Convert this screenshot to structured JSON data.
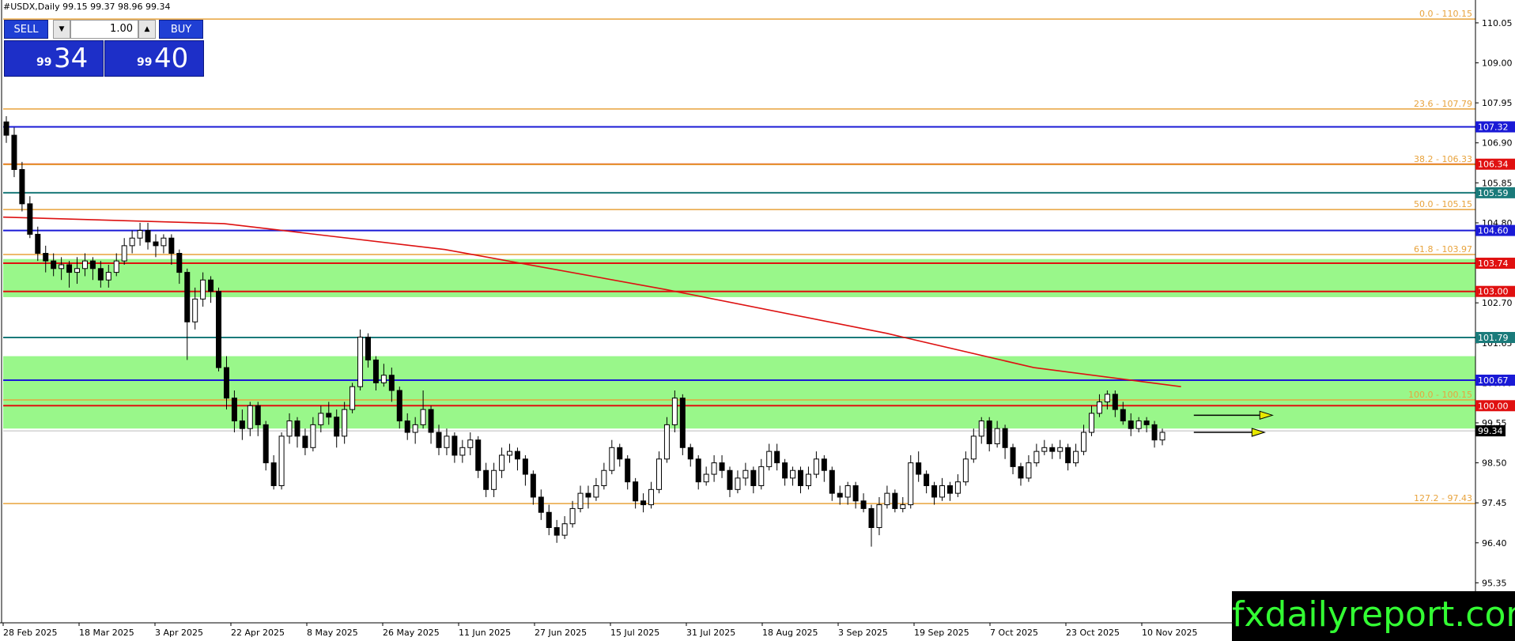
{
  "header": {
    "title": "#USDX,Daily  99.15 99.37 98.96 99.34"
  },
  "trade_panel": {
    "sell_label": "SELL",
    "buy_label": "BUY",
    "lot": "1.00",
    "sell_price_small": "99",
    "sell_price_big": "34",
    "buy_price_small": "99",
    "buy_price_big": "40",
    "down_icon": "triangle-down-icon",
    "up_icon": "triangle-up-icon"
  },
  "watermark": "fxdailyreport.com",
  "chart_data": {
    "type": "candlestick",
    "symbol": "#USDX",
    "timeframe": "Daily",
    "ohlc_last": {
      "open": 99.15,
      "high": 99.37,
      "low": 98.96,
      "close": 99.34
    },
    "last_price_label": "99.34",
    "ylim": [
      94.3,
      110.65
    ],
    "y_ticks": [
      "110.05",
      "109.00",
      "107.95",
      "106.90",
      "105.85",
      "104.80",
      "103.75",
      "102.70",
      "101.65",
      "100.60",
      "99.55",
      "98.50",
      "97.45",
      "96.40",
      "95.35"
    ],
    "x_labels": [
      "28 Feb 2025",
      "18 Mar 2025",
      "3 Apr 2025",
      "22 Apr 2025",
      "8 May 2025",
      "26 May 2025",
      "11 Jun 2025",
      "27 Jun 2025",
      "15 Jul 2025",
      "31 Jul 2025",
      "18 Aug 2025",
      "3 Sep 2025",
      "19 Sep 2025",
      "7 Oct 2025",
      "23 Oct 2025",
      "10 Nov 2025"
    ],
    "fib_levels": [
      {
        "label": "0.0 - 110.15",
        "value": 110.15
      },
      {
        "label": "23.6 - 107.79",
        "value": 107.79
      },
      {
        "label": "38.2 - 106.33",
        "value": 106.33
      },
      {
        "label": "50.0 - 105.15",
        "value": 105.15
      },
      {
        "label": "61.8 - 103.97",
        "value": 103.97
      },
      {
        "label": "100.0 - 100.15",
        "value": 100.15
      },
      {
        "label": "127.2 - 97.43",
        "value": 97.43
      }
    ],
    "fib_color": "#e8a33c",
    "horizontal_levels": [
      {
        "label": "107.32",
        "value": 107.32,
        "color": "#1a1ad6"
      },
      {
        "label": "106.34",
        "value": 106.34,
        "color": "#e0561a",
        "tag_color": "#e01010"
      },
      {
        "label": "105.59",
        "value": 105.59,
        "color": "#1a7a7a"
      },
      {
        "label": "104.60",
        "value": 104.6,
        "color": "#1a1ad6"
      },
      {
        "label": "103.74",
        "value": 103.74,
        "color": "#e01010"
      },
      {
        "label": "103.00",
        "value": 103.0,
        "color": "#e01010"
      },
      {
        "label": "101.79",
        "value": 101.79,
        "color": "#1a7a7a"
      },
      {
        "label": "100.67",
        "value": 100.67,
        "color": "#1a1ad6"
      },
      {
        "label": "100.00",
        "value": 100.0,
        "color": "#e01010"
      }
    ],
    "zones": [
      {
        "from": 102.85,
        "to": 103.85,
        "color": "#99f78a"
      },
      {
        "from": 99.4,
        "to": 101.3,
        "color": "#99f78a"
      }
    ],
    "ma_points": [
      [
        0,
        104.95
      ],
      [
        0.15,
        104.78
      ],
      [
        0.3,
        104.1
      ],
      [
        0.45,
        103.05
      ],
      [
        0.6,
        101.9
      ],
      [
        0.7,
        101.0
      ],
      [
        0.8,
        100.5
      ]
    ],
    "ma_color": "#dd1111",
    "candles": [
      [
        107.45,
        107.1,
        107.6,
        106.9
      ],
      [
        107.1,
        106.2,
        107.3,
        106.0
      ],
      [
        106.2,
        105.3,
        106.4,
        105.1
      ],
      [
        105.3,
        104.5,
        105.5,
        104.4
      ],
      [
        104.5,
        104.0,
        104.7,
        103.8
      ],
      [
        104.0,
        103.8,
        104.2,
        103.5
      ],
      [
        103.8,
        103.6,
        104.0,
        103.4
      ],
      [
        103.6,
        103.7,
        103.9,
        103.3
      ],
      [
        103.7,
        103.5,
        103.8,
        103.1
      ],
      [
        103.5,
        103.6,
        103.9,
        103.2
      ],
      [
        103.6,
        103.8,
        104.0,
        103.4
      ],
      [
        103.8,
        103.6,
        103.9,
        103.3
      ],
      [
        103.6,
        103.3,
        103.8,
        103.1
      ],
      [
        103.3,
        103.5,
        103.7,
        103.1
      ],
      [
        103.5,
        103.8,
        104.0,
        103.4
      ],
      [
        103.8,
        104.2,
        104.4,
        103.7
      ],
      [
        104.2,
        104.4,
        104.6,
        104.0
      ],
      [
        104.4,
        104.6,
        104.8,
        104.2
      ],
      [
        104.6,
        104.3,
        104.8,
        104.1
      ],
      [
        104.3,
        104.2,
        104.5,
        103.9
      ],
      [
        104.2,
        104.4,
        104.5,
        104.0
      ],
      [
        104.4,
        104.0,
        104.5,
        103.7
      ],
      [
        104.0,
        103.5,
        104.1,
        103.2
      ],
      [
        103.5,
        102.2,
        103.6,
        101.2
      ],
      [
        102.2,
        102.8,
        103.1,
        102.0
      ],
      [
        102.8,
        103.3,
        103.5,
        102.6
      ],
      [
        103.3,
        103.0,
        103.4,
        102.7
      ],
      [
        103.0,
        101.0,
        103.1,
        100.9
      ],
      [
        101.0,
        100.2,
        101.3,
        99.9
      ],
      [
        100.2,
        99.6,
        100.4,
        99.3
      ],
      [
        99.6,
        99.4,
        99.9,
        99.1
      ],
      [
        99.4,
        100.0,
        100.1,
        99.2
      ],
      [
        100.0,
        99.5,
        100.1,
        99.2
      ],
      [
        99.5,
        98.5,
        99.6,
        98.3
      ],
      [
        98.5,
        97.9,
        98.7,
        97.8
      ],
      [
        97.9,
        99.2,
        99.3,
        97.8
      ],
      [
        99.2,
        99.6,
        99.8,
        99.0
      ],
      [
        99.6,
        99.2,
        99.7,
        98.9
      ],
      [
        99.2,
        98.9,
        99.4,
        98.7
      ],
      [
        98.9,
        99.5,
        99.7,
        98.8
      ],
      [
        99.5,
        99.8,
        100.0,
        99.3
      ],
      [
        99.8,
        99.7,
        100.1,
        99.5
      ],
      [
        99.7,
        99.2,
        99.9,
        98.9
      ],
      [
        99.2,
        99.9,
        100.1,
        99.0
      ],
      [
        99.9,
        100.5,
        100.6,
        99.8
      ],
      [
        100.5,
        101.8,
        102.0,
        100.4
      ],
      [
        101.8,
        101.2,
        101.9,
        101.0
      ],
      [
        101.2,
        100.6,
        101.3,
        100.4
      ],
      [
        100.6,
        100.8,
        101.1,
        100.5
      ],
      [
        100.8,
        100.4,
        101.0,
        100.1
      ],
      [
        100.4,
        99.6,
        100.5,
        99.4
      ],
      [
        99.6,
        99.3,
        99.8,
        99.1
      ],
      [
        99.3,
        99.5,
        99.7,
        99.0
      ],
      [
        99.5,
        99.9,
        100.4,
        99.4
      ],
      [
        99.9,
        99.3,
        100.0,
        99.0
      ],
      [
        99.3,
        98.9,
        99.5,
        98.7
      ],
      [
        98.9,
        99.2,
        99.4,
        98.7
      ],
      [
        99.2,
        98.7,
        99.3,
        98.5
      ],
      [
        98.7,
        98.9,
        99.1,
        98.5
      ],
      [
        98.9,
        99.1,
        99.3,
        98.7
      ],
      [
        99.1,
        98.3,
        99.2,
        98.1
      ],
      [
        98.3,
        97.8,
        98.5,
        97.6
      ],
      [
        97.8,
        98.3,
        98.5,
        97.6
      ],
      [
        98.3,
        98.7,
        98.9,
        98.1
      ],
      [
        98.7,
        98.8,
        99.0,
        98.5
      ],
      [
        98.8,
        98.6,
        98.9,
        98.3
      ],
      [
        98.6,
        98.2,
        98.7,
        97.9
      ],
      [
        98.2,
        97.6,
        98.3,
        97.4
      ],
      [
        97.6,
        97.2,
        97.8,
        97.0
      ],
      [
        97.2,
        96.8,
        97.4,
        96.6
      ],
      [
        96.8,
        96.6,
        97.0,
        96.4
      ],
      [
        96.6,
        96.9,
        97.1,
        96.5
      ],
      [
        96.9,
        97.3,
        97.5,
        96.8
      ],
      [
        97.3,
        97.7,
        97.9,
        97.2
      ],
      [
        97.7,
        97.6,
        97.9,
        97.3
      ],
      [
        97.6,
        97.9,
        98.1,
        97.5
      ],
      [
        97.9,
        98.3,
        98.5,
        97.8
      ],
      [
        98.3,
        98.9,
        99.1,
        98.2
      ],
      [
        98.9,
        98.6,
        99.0,
        98.4
      ],
      [
        98.6,
        98.0,
        98.7,
        97.8
      ],
      [
        98.0,
        97.5,
        98.1,
        97.3
      ],
      [
        97.5,
        97.4,
        97.7,
        97.2
      ],
      [
        97.4,
        97.8,
        98.0,
        97.3
      ],
      [
        97.8,
        98.6,
        98.8,
        97.7
      ],
      [
        98.6,
        99.5,
        99.7,
        98.5
      ],
      [
        99.5,
        100.2,
        100.4,
        99.3
      ],
      [
        100.2,
        98.9,
        100.3,
        98.7
      ],
      [
        98.9,
        98.6,
        99.0,
        98.4
      ],
      [
        98.6,
        98.0,
        98.7,
        97.8
      ],
      [
        98.0,
        98.2,
        98.4,
        97.9
      ],
      [
        98.2,
        98.5,
        98.7,
        98.0
      ],
      [
        98.5,
        98.3,
        98.7,
        98.1
      ],
      [
        98.3,
        97.8,
        98.4,
        97.6
      ],
      [
        97.8,
        98.1,
        98.3,
        97.7
      ],
      [
        98.1,
        98.3,
        98.5,
        97.9
      ],
      [
        98.3,
        97.9,
        98.4,
        97.7
      ],
      [
        97.9,
        98.4,
        98.6,
        97.8
      ],
      [
        98.4,
        98.8,
        99.0,
        98.3
      ],
      [
        98.8,
        98.5,
        99.0,
        98.3
      ],
      [
        98.5,
        98.1,
        98.6,
        97.9
      ],
      [
        98.1,
        98.3,
        98.4,
        97.9
      ],
      [
        98.3,
        97.9,
        98.4,
        97.7
      ],
      [
        97.9,
        98.2,
        98.4,
        97.8
      ],
      [
        98.2,
        98.6,
        98.8,
        98.1
      ],
      [
        98.6,
        98.3,
        98.7,
        98.0
      ],
      [
        98.3,
        97.7,
        98.4,
        97.5
      ],
      [
        97.7,
        97.6,
        97.9,
        97.4
      ],
      [
        97.6,
        97.9,
        98.0,
        97.4
      ],
      [
        97.9,
        97.5,
        98.0,
        97.3
      ],
      [
        97.5,
        97.3,
        97.7,
        97.2
      ],
      [
        97.3,
        96.8,
        97.4,
        96.3
      ],
      [
        96.8,
        97.4,
        97.6,
        96.6
      ],
      [
        97.4,
        97.7,
        97.9,
        97.3
      ],
      [
        97.7,
        97.3,
        97.8,
        97.2
      ],
      [
        97.3,
        97.4,
        97.6,
        97.2
      ],
      [
        97.4,
        98.5,
        98.7,
        97.3
      ],
      [
        98.5,
        98.2,
        98.8,
        98.0
      ],
      [
        98.2,
        97.9,
        98.3,
        97.7
      ],
      [
        97.9,
        97.6,
        98.0,
        97.4
      ],
      [
        97.6,
        97.9,
        98.1,
        97.5
      ],
      [
        97.9,
        97.7,
        98.0,
        97.5
      ],
      [
        97.7,
        98.0,
        98.2,
        97.6
      ],
      [
        98.0,
        98.6,
        98.8,
        97.9
      ],
      [
        98.6,
        99.2,
        99.4,
        98.5
      ],
      [
        99.2,
        99.6,
        99.7,
        99.0
      ],
      [
        99.6,
        99.0,
        99.7,
        98.8
      ],
      [
        99.0,
        99.4,
        99.6,
        98.9
      ],
      [
        99.4,
        98.9,
        99.5,
        98.6
      ],
      [
        98.9,
        98.4,
        99.0,
        98.2
      ],
      [
        98.4,
        98.1,
        98.5,
        97.9
      ],
      [
        98.1,
        98.5,
        98.7,
        98.0
      ],
      [
        98.5,
        98.8,
        99.0,
        98.4
      ],
      [
        98.8,
        98.9,
        99.1,
        98.7
      ],
      [
        98.9,
        98.8,
        99.0,
        98.6
      ],
      [
        98.8,
        98.9,
        99.1,
        98.6
      ],
      [
        98.9,
        98.5,
        99.0,
        98.3
      ],
      [
        98.5,
        98.8,
        99.0,
        98.4
      ],
      [
        98.8,
        99.3,
        99.5,
        98.7
      ],
      [
        99.3,
        99.8,
        100.0,
        99.2
      ],
      [
        99.8,
        100.1,
        100.3,
        99.7
      ],
      [
        100.1,
        100.3,
        100.4,
        99.9
      ],
      [
        100.3,
        99.9,
        100.4,
        99.7
      ],
      [
        99.9,
        99.6,
        100.1,
        99.5
      ],
      [
        99.6,
        99.4,
        99.8,
        99.2
      ],
      [
        99.4,
        99.6,
        99.7,
        99.3
      ],
      [
        99.6,
        99.5,
        99.7,
        99.3
      ],
      [
        99.5,
        99.1,
        99.6,
        98.9
      ],
      [
        99.1,
        99.3,
        99.4,
        98.96
      ]
    ],
    "arrows": [
      {
        "from_index": 151,
        "to_index": 161,
        "value": 99.75,
        "color": "#e8e800"
      },
      {
        "from_index": 151,
        "to_index": 160,
        "value": 99.3,
        "color": "#e8e800"
      }
    ]
  }
}
